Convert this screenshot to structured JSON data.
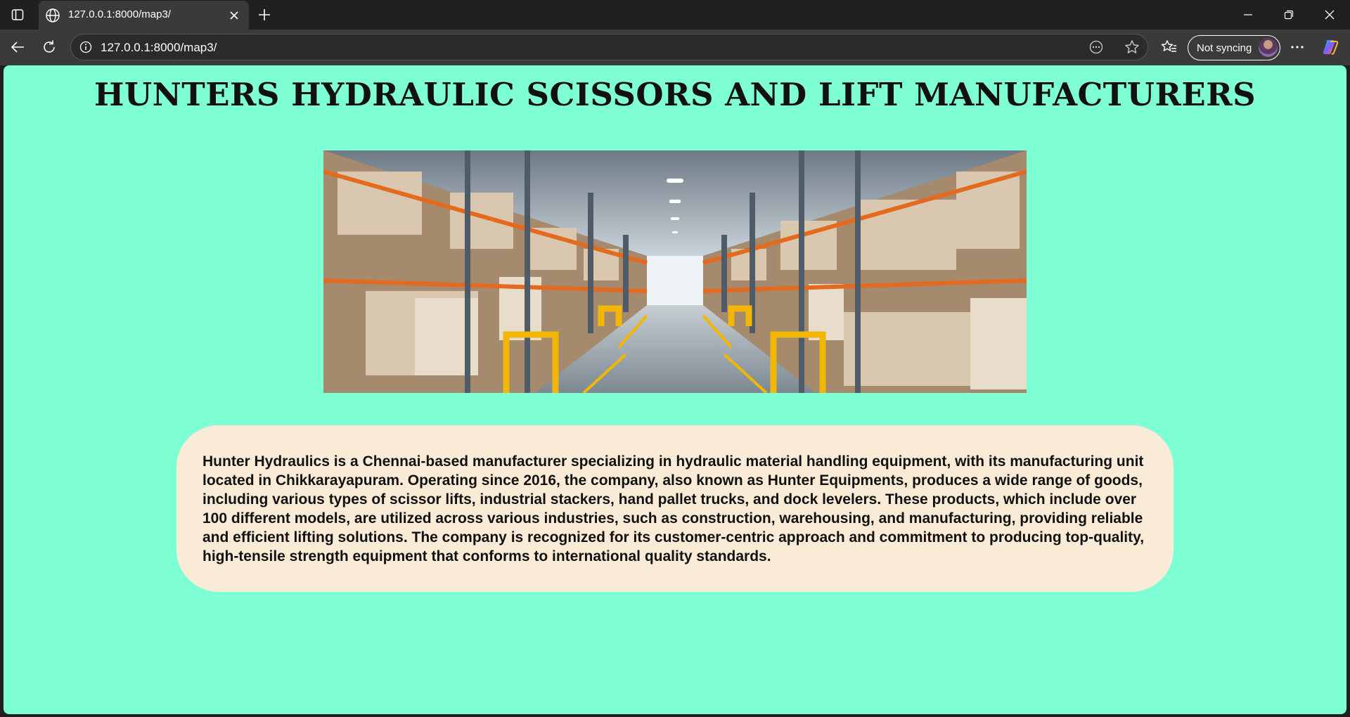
{
  "browser": {
    "tab": {
      "title": "127.0.0.1:8000/map3/",
      "favicon": "globe-icon"
    },
    "address": {
      "url": "127.0.0.1:8000/map3/"
    },
    "profile": {
      "label": "Not syncing"
    },
    "icons": [
      "sidebar-toggle-icon",
      "close-icon",
      "plus-icon",
      "minimize-icon",
      "restore-icon",
      "close-window-icon",
      "back-arrow-icon",
      "refresh-icon",
      "info-icon",
      "read-aloud-icon",
      "star-icon",
      "favorites-icon",
      "more-icon",
      "copilot-icon"
    ]
  },
  "page": {
    "background": "#7fffd4",
    "title": "HUNTERS HYDRAULIC SCISSORS AND LIFT MANUFACTURERS",
    "hero_image": "warehouse-aisle-photo",
    "card_background": "#faebd7",
    "description": "Hunter Hydraulics is a Chennai-based manufacturer specializing in hydraulic material handling equipment, with its manufacturing unit located in Chikkarayapuram. Operating since 2016, the company, also known as Hunter Equipments, produces a wide range of goods, including various types of scissor lifts, industrial stackers, hand pallet trucks, and dock levelers. These products, which include over 100 different models, are utilized across various industries, such as construction, warehousing, and manufacturing, providing reliable and efficient lifting solutions. The company is recognized for its customer-centric approach and commitment to producing top-quality, high-tensile strength equipment that conforms to international quality standards."
  }
}
